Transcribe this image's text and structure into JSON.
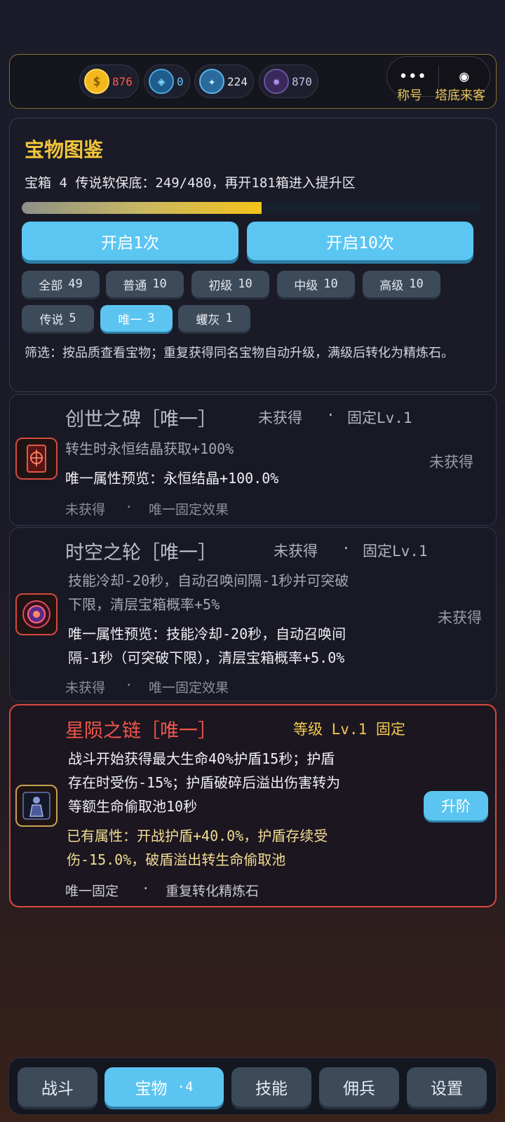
{
  "resources": [
    {
      "icon": "gold-coin-icon",
      "glyph": "$",
      "value": "876",
      "color": "#ff5a4a"
    },
    {
      "icon": "blue-gem-icon",
      "glyph": "◈",
      "value": "0",
      "color": "#5cc8ff"
    },
    {
      "icon": "crystal-icon",
      "glyph": "✦",
      "value": "224",
      "color": "#e8e8ec"
    },
    {
      "icon": "purple-crystal-icon",
      "glyph": "✸",
      "value": "870",
      "color": "#c6c0e6"
    }
  ],
  "capsule": {
    "menu_glyph": "•••",
    "target_glyph": "◉",
    "label_title": "称号",
    "label_guest": "塔底来客"
  },
  "panel": {
    "title": "宝物图鉴",
    "info": "宝箱 4  传说软保底：249/480，再开181箱进入提升区",
    "progress": 0.519,
    "open_once": "开启1次",
    "open_ten": "开启10次",
    "filters": [
      {
        "name": "全部",
        "count": "49"
      },
      {
        "name": "普通",
        "count": "10"
      },
      {
        "name": "初级",
        "count": "10"
      },
      {
        "name": "中级",
        "count": "10"
      },
      {
        "name": "高级",
        "count": "10"
      },
      {
        "name": "传说",
        "count": "5"
      },
      {
        "name": "唯一",
        "count": "3"
      },
      {
        "name": "蠼灰",
        "count": "1"
      }
    ],
    "note": "筛选：按品质查看宝物；重复获得同名宝物自动升级，满级后转化为精炼石。"
  },
  "cards": [
    {
      "title": "创世之碑［唯一］",
      "status": "未获得",
      "dot": "·",
      "level": "固定Lv.1",
      "desc": "转生时永恒结晶获取+100%",
      "preview": "唯一属性预览：永恒结晶+100.0%",
      "foot_a": "未获得",
      "foot_b": "唯一固定效果",
      "side": "未获得"
    },
    {
      "title": "时空之轮［唯一］",
      "status": "未获得",
      "dot": "·",
      "level": "固定Lv.1",
      "desc1": "技能冷却-20秒，自动召唤间隔-1秒并可突破",
      "desc2": "下限，清层宝箱概率+5%",
      "preview1": "唯一属性预览：技能冷却-20秒，自动召唤间",
      "preview2": "隔-1秒（可突破下限），清层宝箱概率+5.0%",
      "foot_a": "未获得",
      "foot_b": "唯一固定效果",
      "side": "未获得"
    },
    {
      "title": "星陨之链［唯一］",
      "status": "等级 Lv.1 固定",
      "desc1": "战斗开始获得最大生命40%护盾15秒；护盾",
      "desc2": "存在时受伤-15%；护盾破碎后溢出伤害转为",
      "desc3": "等额生命偷取池10秒",
      "attr1": "已有属性：开战护盾+40.0%，护盾存续受",
      "attr2": "伤-15.0%，破盾溢出转生命偷取池",
      "foot_a": "唯一固定",
      "foot_b": "重复转化精炼石",
      "upgrade": "升阶"
    }
  ],
  "nav": {
    "battle": "战斗",
    "treasure": "宝物",
    "treasure_badge": "·4",
    "skills": "技能",
    "mercs": "佣兵",
    "settings": "设置"
  }
}
